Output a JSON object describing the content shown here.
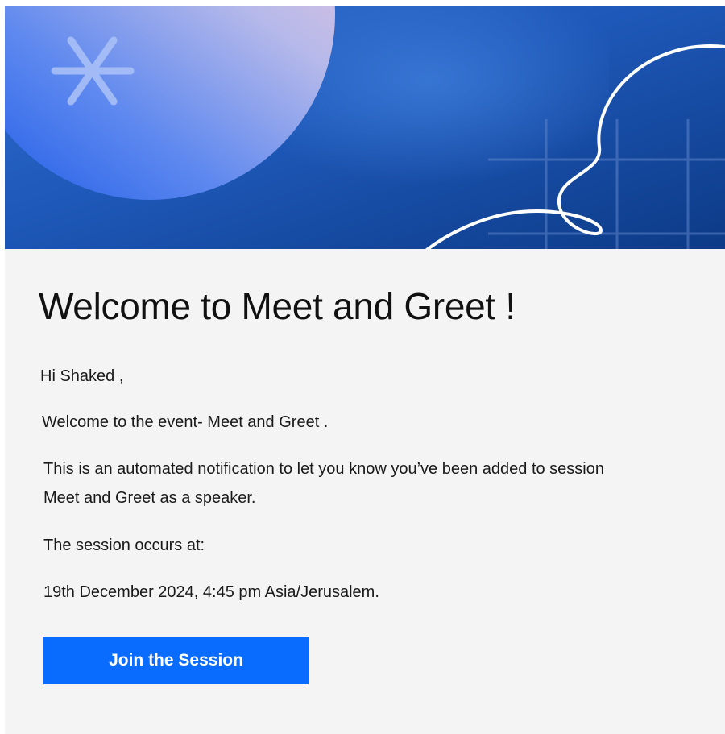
{
  "email": {
    "title": "Welcome to Meet and Greet !",
    "greeting": "Hi Shaked ,",
    "welcome_line": "Welcome to the event- Meet and Greet .",
    "notification_line1": "This is an automated notification to let you know you’ve been added to session",
    "notification_line2": "Meet and Greet as a speaker.",
    "occurs_label": "The session occurs at:",
    "datetime": "19th December 2024, 4:45 pm Asia/Jerusalem.",
    "join_button_label": "Join the Session"
  },
  "banner": {
    "icons": [
      "asterisk-icon",
      "swirl-line",
      "grid-lines"
    ]
  },
  "colors": {
    "banner_dark_blue": "#0e3d8c",
    "banner_circle_light": "#e8c4dd",
    "banner_circle_blue": "#2a63e6",
    "button_blue": "#0a6cff",
    "background": "#f4f4f4"
  }
}
